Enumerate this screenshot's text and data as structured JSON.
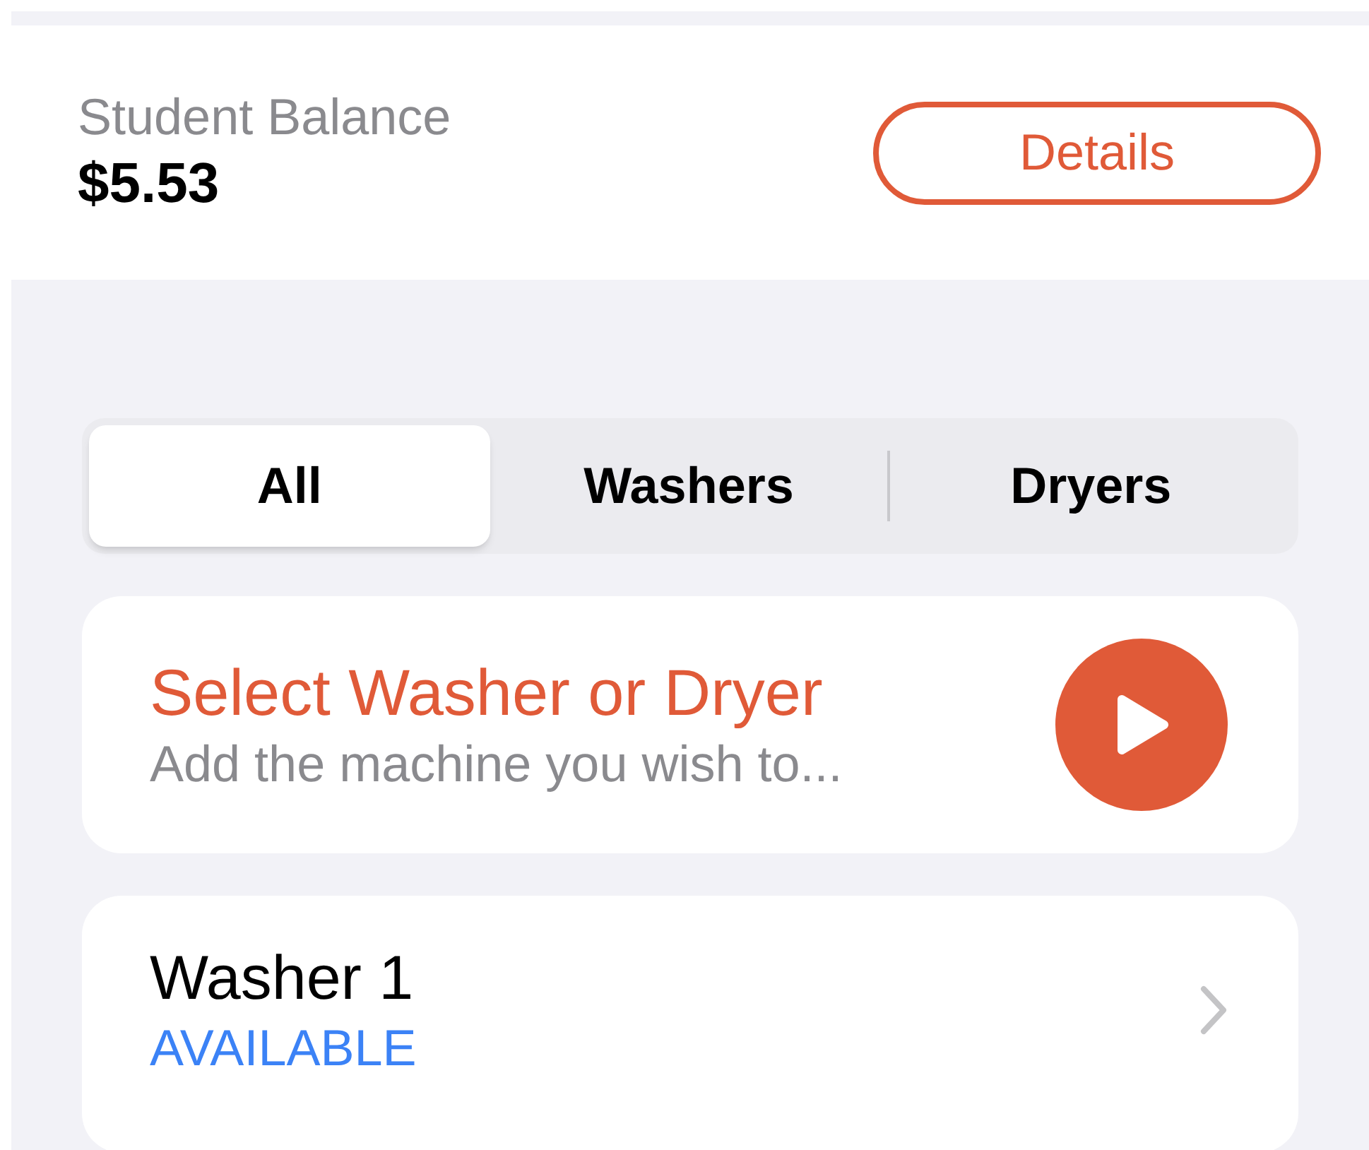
{
  "balance": {
    "label": "Student Balance",
    "amount": "$5.53",
    "button": "Details"
  },
  "tabs": [
    {
      "label": "All",
      "selected": true
    },
    {
      "label": "Washers",
      "selected": false
    },
    {
      "label": "Dryers",
      "selected": false
    }
  ],
  "prompt_card": {
    "title": "Select Washer or Dryer",
    "subtitle": "Add the machine you wish to..."
  },
  "machines": [
    {
      "name": "Washer 1",
      "status": "AVAILABLE"
    }
  ]
}
